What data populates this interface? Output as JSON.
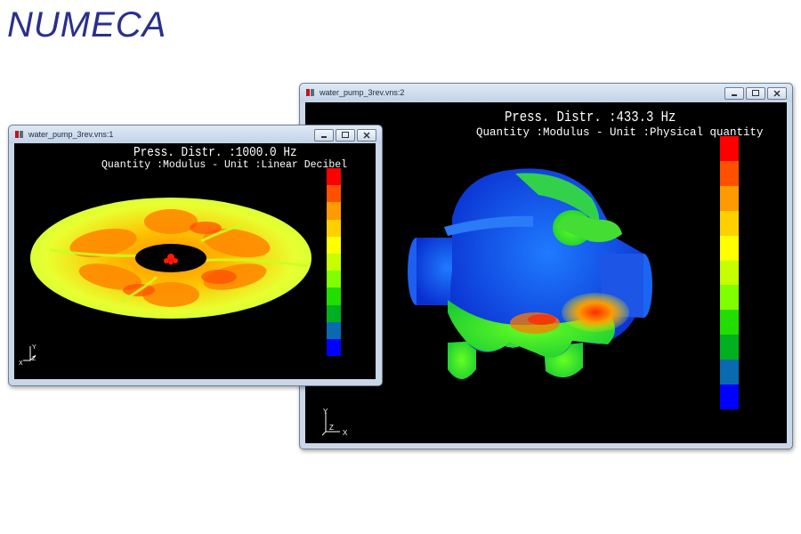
{
  "logo": {
    "text": "NUMECA"
  },
  "windows": [
    {
      "title": "water_pump_3rev.vns:1",
      "plot_title": "Press. Distr.  :1000.0 Hz",
      "plot_subtitle": "Quantity :Modulus - Unit :Linear Decibel",
      "axes": {
        "x": "X",
        "y": "Y",
        "z": "Z"
      },
      "legend_colors": [
        "#ff0000",
        "#ff5000",
        "#ff9a00",
        "#ffd000",
        "#ffff00",
        "#c8ff00",
        "#80ff00",
        "#22dd00",
        "#00b020",
        "#0a6ab0",
        "#0000ff"
      ]
    },
    {
      "title": "water_pump_3rev.vns:2",
      "plot_title": "Press. Distr.  :433.3 Hz",
      "plot_subtitle": "Quantity :Modulus - Unit :Physical quantity",
      "axes": {
        "x": "X",
        "y": "Y",
        "z": "Z"
      },
      "legend_colors": [
        "#ff0000",
        "#ff5000",
        "#ff9a00",
        "#ffd000",
        "#ffff00",
        "#c8ff00",
        "#80ff00",
        "#22dd00",
        "#00b020",
        "#0a6ab0",
        "#0000ff"
      ]
    }
  ]
}
